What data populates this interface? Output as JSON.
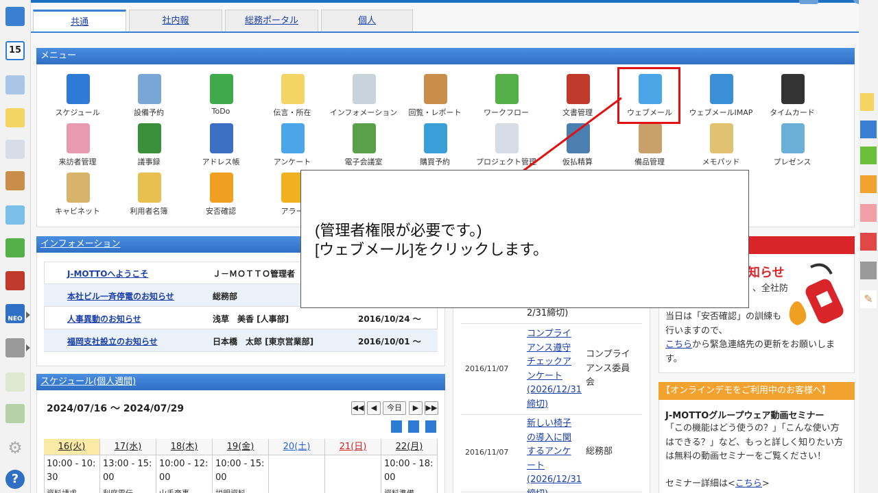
{
  "tabs": [
    {
      "label": "共通",
      "active": true
    },
    {
      "label": "社内報",
      "active": false
    },
    {
      "label": "総務ポータル",
      "active": false
    },
    {
      "label": "個人",
      "active": false
    }
  ],
  "menu": {
    "title": "メニュー",
    "items": [
      {
        "label": "スケジュール",
        "icon": "calendar-icon",
        "color": "#2e7bd6"
      },
      {
        "label": "設備予約",
        "icon": "equipment-icon",
        "color": "#7aa6d6"
      },
      {
        "label": "ToDo",
        "icon": "todo-icon",
        "color": "#3faa4a"
      },
      {
        "label": "伝言・所在",
        "icon": "memo-note-icon",
        "color": "#f3d465"
      },
      {
        "label": "インフォメーション",
        "icon": "information-board-icon",
        "color": "#c9d3dc"
      },
      {
        "label": "回覧・レポート",
        "icon": "clipboard-icon",
        "color": "#c98f4a"
      },
      {
        "label": "ワークフロー",
        "icon": "workflow-icon",
        "color": "#55b04a"
      },
      {
        "label": "文書管理",
        "icon": "binders-icon",
        "color": "#c0392b"
      },
      {
        "label": "ウェブメール",
        "icon": "webmail-icon",
        "color": "#4aa6e6"
      },
      {
        "label": "ウェブメールIMAP",
        "icon": "webmail-imap-icon",
        "color": "#3a8fd6"
      },
      {
        "label": "タイムカード",
        "icon": "timecard-icon",
        "color": "#333333"
      },
      {
        "label": "来訪者管理",
        "icon": "receptionist-icon",
        "color": "#e89ab0"
      },
      {
        "label": "議事録",
        "icon": "minutes-icon",
        "color": "#3a8f3a"
      },
      {
        "label": "アドレス帳",
        "icon": "address-book-icon",
        "color": "#3a6fc4"
      },
      {
        "label": "アンケート",
        "icon": "survey-icon",
        "color": "#4aa6e6"
      },
      {
        "label": "電子会議室",
        "icon": "meeting-room-icon",
        "color": "#5aa04a"
      },
      {
        "label": "購買予約",
        "icon": "shopping-cart-icon",
        "color": "#3a9fd6"
      },
      {
        "label": "プロジェクト管理",
        "icon": "project-chart-icon",
        "color": "#d6dde6"
      },
      {
        "label": "仮払精算",
        "icon": "calculator-icon",
        "color": "#4a7fb0"
      },
      {
        "label": "備品管理",
        "icon": "box-icon",
        "color": "#c9a06a"
      },
      {
        "label": "メモパッド",
        "icon": "memopad-icon",
        "color": "#e0c270"
      },
      {
        "label": "プレゼンス",
        "icon": "presence-icon",
        "color": "#6ab0d6"
      },
      {
        "label": "キャビネット",
        "icon": "cabinet-icon",
        "color": "#d8b46a"
      },
      {
        "label": "利用者名簿",
        "icon": "user-list-icon",
        "color": "#e8c050"
      },
      {
        "label": "安否確認",
        "icon": "safety-confirm-icon",
        "color": "#f0a020"
      },
      {
        "label": "アラー",
        "icon": "alarm-bell-icon",
        "color": "#f0b020"
      }
    ]
  },
  "information": {
    "title": "インフォメーション",
    "rows": [
      {
        "title": "J-MOTTOへようこそ",
        "author": "Ｊ－ＭＯＴＴＯ管理者",
        "date": ""
      },
      {
        "title": "本社ビル一斉停電のお知らせ",
        "author": "総務部",
        "date": ""
      },
      {
        "title": "人事異動のお知らせ",
        "author": "浅草　美香 [人事部]",
        "date": "2016/10/24 ～"
      },
      {
        "title": "福岡支社設立のお知らせ",
        "author": "日本橋　太郎 [東京営業部]",
        "date": "2016/10/01 ～"
      }
    ]
  },
  "schedule": {
    "title": "スケジュール(個人週間)",
    "range": "2024/07/16 ～ 2024/07/29",
    "today_label": "今日",
    "days": [
      {
        "label": "16(火)",
        "color": "#222222",
        "bg": "#fbe9a6",
        "entry": "10:00 - 10:\n30",
        "item": "資料請求"
      },
      {
        "label": "17(水)",
        "color": "#222222",
        "bg": "#f7f7f7",
        "entry": "13:00 - 15:\n00",
        "item": "利庭電伝"
      },
      {
        "label": "18(木)",
        "color": "#222222",
        "bg": "#f7f7f7",
        "entry": "10:00 - 12:\n00",
        "item": "山手商事"
      },
      {
        "label": "19(金)",
        "color": "#222222",
        "bg": "#f7f7f7",
        "entry": "10:00 - 15:\n00",
        "item": "説明資料"
      },
      {
        "label": "20(土)",
        "color": "#2a62c9",
        "bg": "#f7f7f7",
        "entry": "",
        "item": ""
      },
      {
        "label": "21(日)",
        "color": "#d12020",
        "bg": "#f7f7f7",
        "entry": "",
        "item": ""
      },
      {
        "label": "22(月)",
        "color": "#222222",
        "bg": "#f7f7f7",
        "entry": "10:00 - 18:\n00",
        "item": "資料準備"
      }
    ]
  },
  "surveys": {
    "rows": [
      {
        "date": "",
        "title": "2/31締切)",
        "by": ""
      },
      {
        "date": "2016/11/07",
        "title": "コンプライアンス遵守チェックアンケート(2026/12/31締切)",
        "by": "コンプライアンス委員会"
      },
      {
        "date": "2016/11/07",
        "title": "新しい椅子の導入に関するアンケート(2026/12/31締切)",
        "by": "総務部"
      }
    ]
  },
  "notices": {
    "headline": "知らせ",
    "sub": "、全社防",
    "body1": "当日は「安否確認」の訓練も行いますので、",
    "link": "こちら",
    "body2": "から緊急連絡先の更新をお願いします。",
    "demo_header": "【オンラインデモをご利用中のお客様へ】",
    "demo_title": "J-MOTTOグループウェア動画セミナー",
    "demo_body": "「この機能はどう使うの？」「こんな使い方はできる？」など、もっと詳しく知りたい方は無料の動画セミナーをご覧ください！",
    "demo_more_prefix": "セミナー詳細は<",
    "demo_more_link": "こちら",
    "demo_more_suffix": ">"
  },
  "callout": {
    "line1": "(管理者権限が必要です。)",
    "line2": "[ウェブメール]をクリックします。"
  },
  "sidebar": {
    "icons": [
      "portal-icon",
      "calendar-icon",
      "equipment-icon",
      "memo-note-icon",
      "information-board-icon",
      "clipboard-icon",
      "survey-icon",
      "workflow-icon",
      "binders-icon",
      "neo-icon",
      "folder-icon",
      "tanomaru-icon",
      "map-icon",
      "settings-icon",
      "help-icon"
    ],
    "calendar_day": "15",
    "neo_label": "NEO"
  },
  "colors": {
    "accent": "#2f6fc4",
    "highlight": "#e21111",
    "link": "#1a3fa8"
  }
}
